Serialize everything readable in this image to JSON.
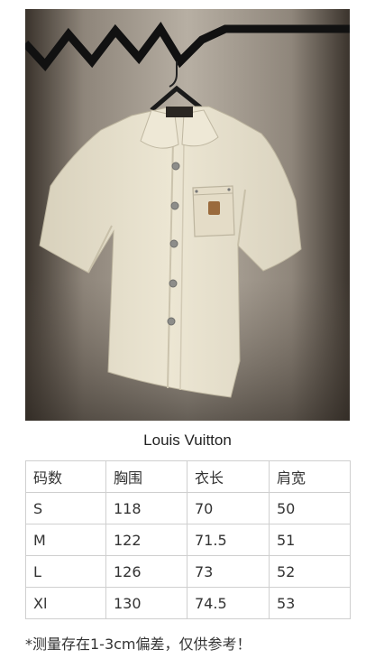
{
  "brand": "Louis Vuitton",
  "size_table": {
    "headers": [
      "码数",
      "胸围",
      "衣长",
      "肩宽"
    ],
    "rows": [
      [
        "S",
        "118",
        "70",
        "50"
      ],
      [
        "M",
        "122",
        "71.5",
        "51"
      ],
      [
        "L",
        "126",
        "73",
        "52"
      ],
      [
        "Xl",
        "130",
        "74.5",
        "53"
      ]
    ]
  },
  "note": "*测量存在1-3cm偏差，仅供参考！",
  "colors": {
    "shirt": "#e7e0cc",
    "background_dark": "#3a332c",
    "background_light": "#b7afa3",
    "patch": "#9a6a3c"
  }
}
